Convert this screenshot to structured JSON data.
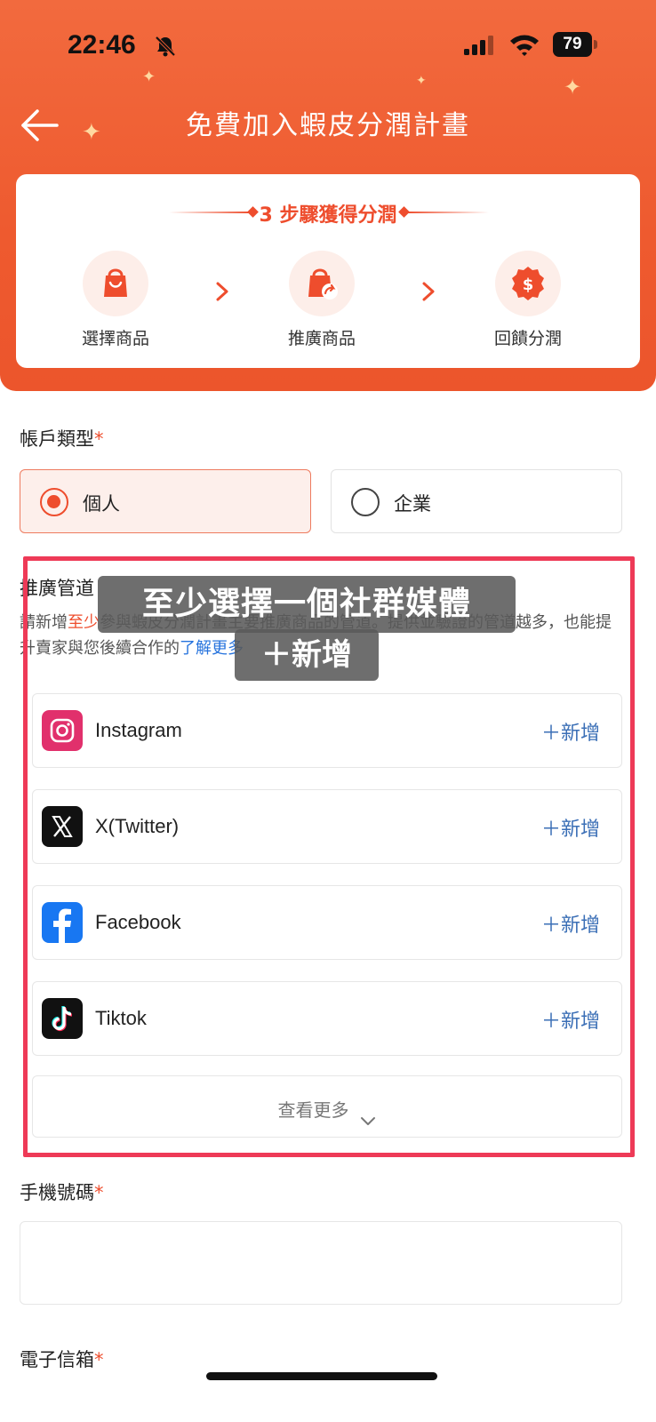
{
  "status_bar": {
    "time": "22:46",
    "battery": "79",
    "icons": [
      "bell-slash-icon",
      "cellular-signal-icon",
      "wifi-icon",
      "battery-icon"
    ]
  },
  "header": {
    "title": "免費加入蝦皮分潤計畫",
    "back_icon": "arrow-left-icon",
    "background_color": "#ef5d31"
  },
  "steps": {
    "heading": "3 步驟獲得分潤",
    "items": [
      {
        "label": "選擇商品",
        "icon": "shopping-bag-icon"
      },
      {
        "label": "推廣商品",
        "icon": "share-bag-icon"
      },
      {
        "label": "回饋分潤",
        "icon": "dollar-badge-icon"
      }
    ],
    "accent_color": "#ee4d2d"
  },
  "account_type": {
    "label": "帳戶類型",
    "required_mark": "*",
    "options": [
      {
        "label": "個人",
        "selected": true
      },
      {
        "label": "企業",
        "selected": false
      }
    ]
  },
  "channels": {
    "label": "推廣管道",
    "desc_prefix": "請新增",
    "desc_highlight": "至少",
    "desc_rest": "參與蝦皮分潤計畫主要推廣商品的管道。提供並驗證的管道越多，也能提升賣家與您後續合作的",
    "desc_link": "了解更多",
    "items": [
      {
        "name": "Instagram",
        "add_label": "＋新增",
        "icon": "instagram-icon"
      },
      {
        "name": "X(Twitter)",
        "add_label": "＋新增",
        "icon": "x-twitter-icon"
      },
      {
        "name": "Facebook",
        "add_label": "＋新增",
        "icon": "facebook-icon"
      },
      {
        "name": "Tiktok",
        "add_label": "＋新增",
        "icon": "tiktok-icon"
      }
    ],
    "see_more": "查看更多"
  },
  "annotation": {
    "line1": "至少選擇一個社群媒體",
    "line2": "＋新增",
    "frame_color": "#ee3a57"
  },
  "phone": {
    "label": "手機號碼",
    "required_mark": "*",
    "value": ""
  },
  "email": {
    "label": "電子信箱",
    "required_mark": "*"
  }
}
